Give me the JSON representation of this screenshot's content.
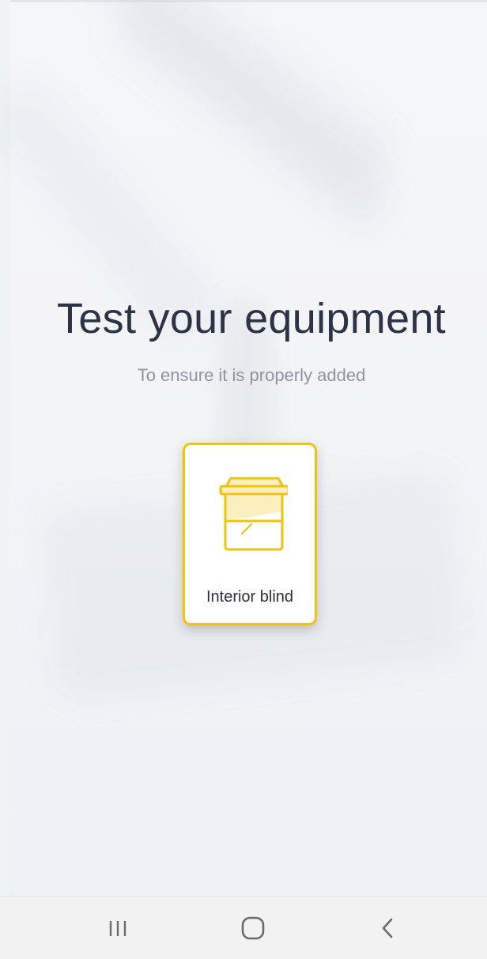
{
  "screen": {
    "title": "Test your equipment",
    "subtitle": "To ensure it is properly added"
  },
  "equipment": {
    "label": "Interior blind",
    "icon": "interior-blind-icon"
  },
  "colors": {
    "accent": "#f0c20f",
    "title": "#2b3446",
    "subtitle": "#8a94a3"
  },
  "navbar": {
    "recents_icon": "recents-icon",
    "home_icon": "home-icon",
    "back_icon": "back-icon"
  }
}
